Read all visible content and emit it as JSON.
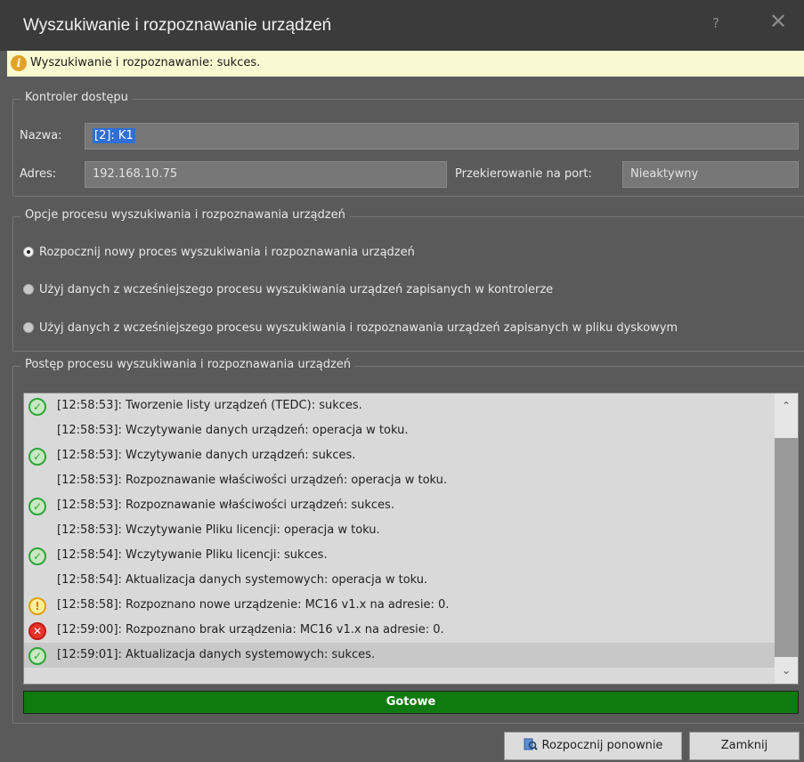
{
  "window": {
    "title": "Wyszukiwanie i rozpoznawanie urządzeń",
    "help_label": "?",
    "close_label": "✕"
  },
  "info_bar": {
    "text": "Wyszukiwanie i rozpoznawanie: sukces.",
    "icon": "info-icon"
  },
  "controller": {
    "legend": "Kontroler dostępu",
    "name_label": "Nazwa:",
    "name_value": "[2]: K1",
    "address_label": "Adres:",
    "address_value": "192.168.10.75",
    "port_label": "Przekierowanie na port:",
    "port_value": "Nieaktywny"
  },
  "options": {
    "legend": "Opcje procesu wyszukiwania i rozpoznawania urządzeń",
    "items": [
      {
        "label": "Rozpocznij nowy proces wyszukiwania i rozpoznawania urządzeń",
        "selected": true
      },
      {
        "label": "Użyj danych z wcześniejszego procesu wyszukiwania urządzeń zapisanych w kontrolerze",
        "selected": false
      },
      {
        "label": "Użyj danych z wcześniejszego procesu wyszukiwania i rozpoznawania urządzeń zapisanych w pliku dyskowym",
        "selected": false
      }
    ]
  },
  "progress_group": {
    "legend": "Postęp procesu wyszukiwania i rozpoznawania urządzeń",
    "log": [
      {
        "status": "success",
        "text": "[12:58:53]: Tworzenie listy urządzeń (TEDC): sukces."
      },
      {
        "status": "none",
        "text": "[12:58:53]: Wczytywanie danych urządzeń: operacja w toku."
      },
      {
        "status": "success",
        "text": "[12:58:53]: Wczytywanie danych urządzeń: sukces."
      },
      {
        "status": "none",
        "text": "[12:58:53]: Rozpoznawanie właściwości urządzeń: operacja w toku."
      },
      {
        "status": "success",
        "text": "[12:58:53]: Rozpoznawanie właściwości urządzeń: sukces."
      },
      {
        "status": "none",
        "text": "[12:58:53]: Wczytywanie Pliku licencji: operacja w toku."
      },
      {
        "status": "success",
        "text": "[12:58:54]: Wczytywanie Pliku licencji: sukces."
      },
      {
        "status": "none",
        "text": "[12:58:54]: Aktualizacja danych systemowych: operacja w toku."
      },
      {
        "status": "warning",
        "text": "[12:58:58]: Rozpoznano nowe urządzenie: MC16 v1.x na adresie: 0."
      },
      {
        "status": "error",
        "text": "[12:59:00]: Rozpoznano brak urządzenia: MC16 v1.x na adresie: 0."
      },
      {
        "status": "success",
        "text": "[12:59:01]: Aktualizacja danych systemowych: sukces.",
        "highlighted": true
      }
    ],
    "progress_percent": 100,
    "progress_label": "Gotowe"
  },
  "buttons": {
    "restart_label": "Rozpocznij ponownie",
    "close_label": "Zamknij"
  },
  "colors": {
    "progress": "#0f7a0f",
    "info_bg": "#fafad2",
    "selection": "#2f6fd6"
  }
}
